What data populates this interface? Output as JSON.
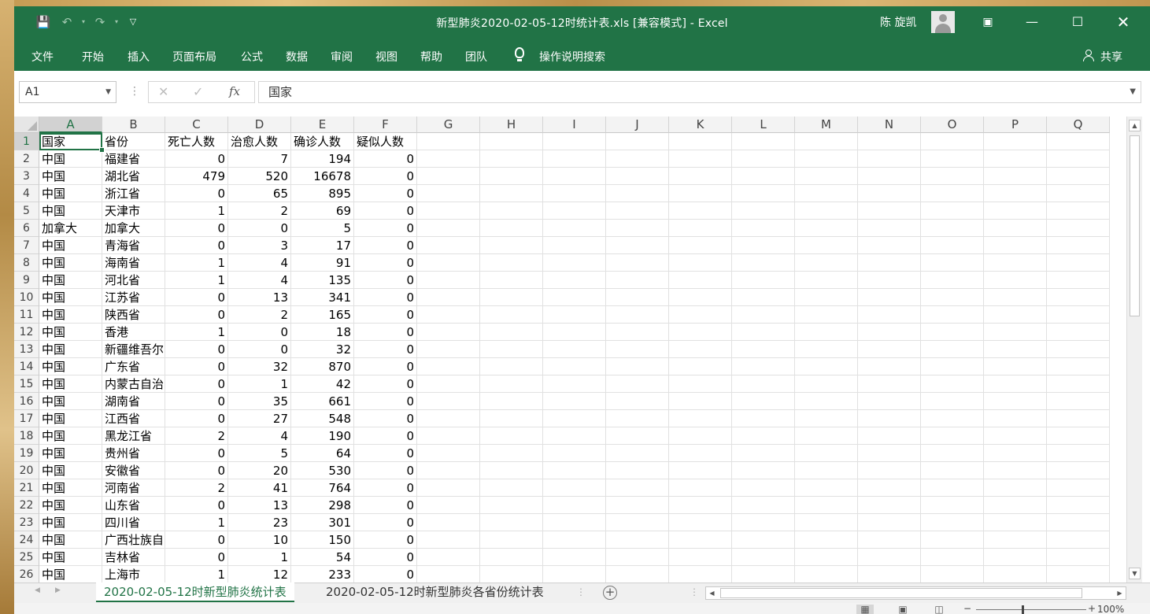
{
  "window": {
    "title": "新型肺炎2020-02-05-12时统计表.xls  [兼容模式]  -  Excel",
    "user_name": "陈 旋凯"
  },
  "ribbon": {
    "tabs": [
      "文件",
      "开始",
      "插入",
      "页面布局",
      "公式",
      "数据",
      "审阅",
      "视图",
      "帮助",
      "团队"
    ],
    "tell_me": "操作说明搜索",
    "share": "共享"
  },
  "formula_bar": {
    "name_box": "A1",
    "fx": "fx",
    "content": "国家"
  },
  "columns": [
    "A",
    "B",
    "C",
    "D",
    "E",
    "F",
    "G",
    "H",
    "I",
    "J",
    "K",
    "L",
    "M",
    "N",
    "O",
    "P",
    "Q"
  ],
  "rows": [
    [
      "国家",
      "省份",
      "死亡人数",
      "治愈人数",
      "确诊人数",
      "疑似人数"
    ],
    [
      "中国",
      "福建省",
      "0",
      "7",
      "194",
      "0"
    ],
    [
      "中国",
      "湖北省",
      "479",
      "520",
      "16678",
      "0"
    ],
    [
      "中国",
      "浙江省",
      "0",
      "65",
      "895",
      "0"
    ],
    [
      "中国",
      "天津市",
      "1",
      "2",
      "69",
      "0"
    ],
    [
      "加拿大",
      "加拿大",
      "0",
      "0",
      "5",
      "0"
    ],
    [
      "中国",
      "青海省",
      "0",
      "3",
      "17",
      "0"
    ],
    [
      "中国",
      "海南省",
      "1",
      "4",
      "91",
      "0"
    ],
    [
      "中国",
      "河北省",
      "1",
      "4",
      "135",
      "0"
    ],
    [
      "中国",
      "江苏省",
      "0",
      "13",
      "341",
      "0"
    ],
    [
      "中国",
      "陕西省",
      "0",
      "2",
      "165",
      "0"
    ],
    [
      "中国",
      "香港",
      "1",
      "0",
      "18",
      "0"
    ],
    [
      "中国",
      "新疆维吾尔",
      "0",
      "0",
      "32",
      "0"
    ],
    [
      "中国",
      "广东省",
      "0",
      "32",
      "870",
      "0"
    ],
    [
      "中国",
      "内蒙古自治",
      "0",
      "1",
      "42",
      "0"
    ],
    [
      "中国",
      "湖南省",
      "0",
      "35",
      "661",
      "0"
    ],
    [
      "中国",
      "江西省",
      "0",
      "27",
      "548",
      "0"
    ],
    [
      "中国",
      "黑龙江省",
      "2",
      "4",
      "190",
      "0"
    ],
    [
      "中国",
      "贵州省",
      "0",
      "5",
      "64",
      "0"
    ],
    [
      "中国",
      "安徽省",
      "0",
      "20",
      "530",
      "0"
    ],
    [
      "中国",
      "河南省",
      "2",
      "41",
      "764",
      "0"
    ],
    [
      "中国",
      "山东省",
      "0",
      "13",
      "298",
      "0"
    ],
    [
      "中国",
      "四川省",
      "1",
      "23",
      "301",
      "0"
    ],
    [
      "中国",
      "广西壮族自",
      "0",
      "10",
      "150",
      "0"
    ],
    [
      "中国",
      "吉林省",
      "0",
      "1",
      "54",
      "0"
    ],
    [
      "中国",
      "上海市",
      "1",
      "12",
      "233",
      "0"
    ]
  ],
  "sheets": [
    {
      "label": "2020-02-05-12时新型肺炎统计表",
      "active": true
    },
    {
      "label": "2020-02-05-12时新型肺炎各省份统计表",
      "active": false
    }
  ],
  "status": {
    "zoom": "100%"
  },
  "colors": {
    "excel_green": "#217346"
  }
}
